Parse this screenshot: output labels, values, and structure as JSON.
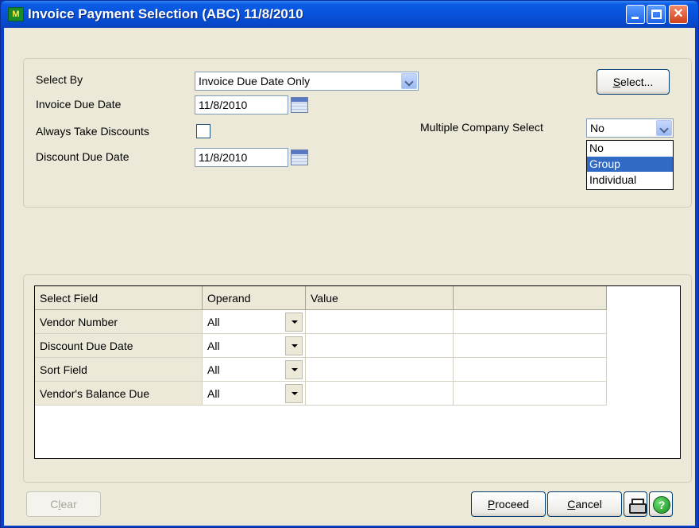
{
  "window": {
    "title": "Invoice Payment Selection (ABC) 11/8/2010",
    "app_icon_text": "M"
  },
  "form": {
    "select_by_label": "Select By",
    "select_by_value": "Invoice Due Date Only",
    "invoice_due_date_label": "Invoice Due Date",
    "invoice_due_date_value": "11/8/2010",
    "always_take_discounts_label": "Always Take Discounts",
    "always_take_discounts_checked": false,
    "discount_due_date_label": "Discount Due Date",
    "discount_due_date_value": "11/8/2010",
    "select_button_acc": "S",
    "select_button_rest": "elect...",
    "multiple_company_label": "Multiple Company Select",
    "multiple_company_value": "No",
    "multiple_company_options": [
      "No",
      "Group",
      "Individual"
    ],
    "multiple_company_highlighted": "Group"
  },
  "grid": {
    "headers": [
      "Select Field",
      "Operand",
      "Value",
      ""
    ],
    "rows": [
      {
        "field": "Vendor Number",
        "operand": "All",
        "value": ""
      },
      {
        "field": "Discount Due Date",
        "operand": "All",
        "value": ""
      },
      {
        "field": "Sort Field",
        "operand": "All",
        "value": ""
      },
      {
        "field": "Vendor's Balance Due",
        "operand": "All",
        "value": ""
      }
    ]
  },
  "footer": {
    "clear_acc": "l",
    "clear_pre": "C",
    "clear_post": "ear",
    "proceed_acc": "P",
    "proceed_rest": "roceed",
    "cancel_acc": "C",
    "cancel_rest": "ancel",
    "help_glyph": "?"
  },
  "colors": {
    "title_bar": "#0852da",
    "client_bg": "#ece9d8",
    "selection": "#316ac5"
  },
  "icons": [
    "app-logo-icon",
    "minimize-icon",
    "maximize-icon",
    "close-icon",
    "calendar-icon",
    "chevron-down-icon",
    "printer-icon",
    "help-icon"
  ]
}
